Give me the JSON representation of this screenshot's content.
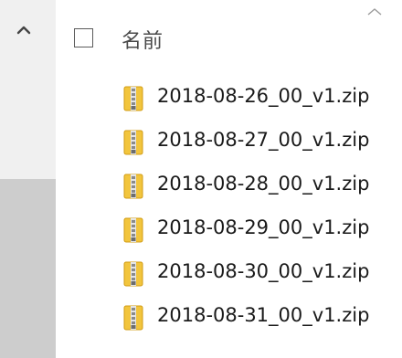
{
  "header": {
    "name_label": "名前",
    "sort": "ascending"
  },
  "icons": {
    "scroll_up": "chevron-up-icon",
    "sort": "sort-ascending-icon",
    "file": "zip-folder-icon"
  },
  "colors": {
    "zip_folder": "#f2c53d",
    "zipper": "#9a9a9a"
  },
  "files": [
    {
      "name": "2018-08-26_00_v1.zip"
    },
    {
      "name": "2018-08-27_00_v1.zip"
    },
    {
      "name": "2018-08-28_00_v1.zip"
    },
    {
      "name": "2018-08-29_00_v1.zip"
    },
    {
      "name": "2018-08-30_00_v1.zip"
    },
    {
      "name": "2018-08-31_00_v1.zip"
    }
  ]
}
